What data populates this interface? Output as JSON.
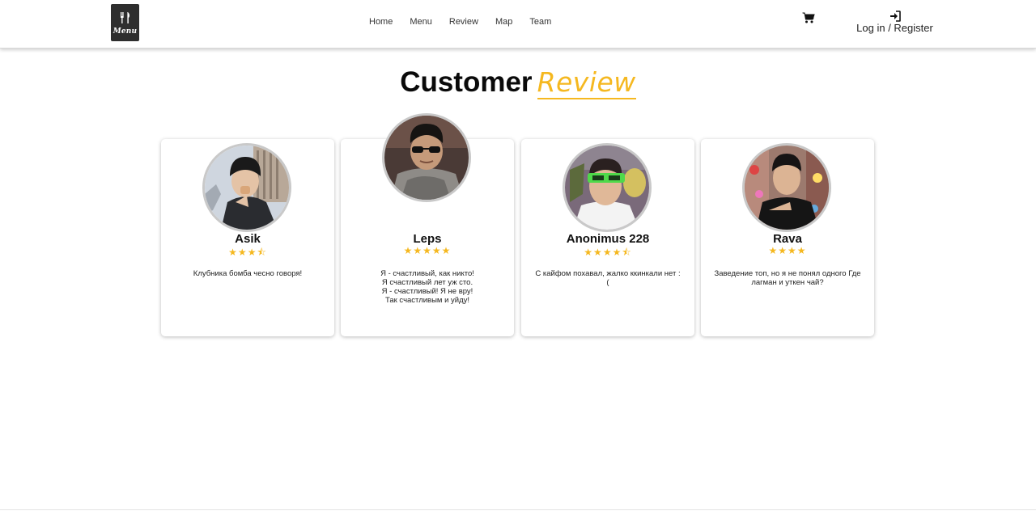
{
  "header": {
    "logo_text": "Menu",
    "nav": [
      "Home",
      "Menu",
      "Review",
      "Map",
      "Team"
    ],
    "login_label": "Log in / Register"
  },
  "title": {
    "main": "Customer",
    "accent": "Review"
  },
  "colors": {
    "accent": "#f5b820",
    "text": "#111111"
  },
  "reviews": [
    {
      "name": "Asik",
      "rating": 3.5,
      "stars": "★★★⯪",
      "text": "Клубника бомба чесно говоря!"
    },
    {
      "name": "Leps",
      "rating": 5,
      "stars": "★★★★★",
      "text": "Я - счастливый, как никто!\nЯ счастливый лет уж сто.\nЯ - счастливый! Я не вру!\nТак счастливым и уйду!"
    },
    {
      "name": "Anonimus 228",
      "rating": 4.5,
      "stars": "★★★★⯪",
      "text": "С кайфом похавал, жалко ккинкали нет :\n("
    },
    {
      "name": "Rava",
      "rating": 4,
      "stars": "★★★★",
      "text": "Заведение топ, но я не понял одного Где лагман и уткен чай?"
    }
  ]
}
